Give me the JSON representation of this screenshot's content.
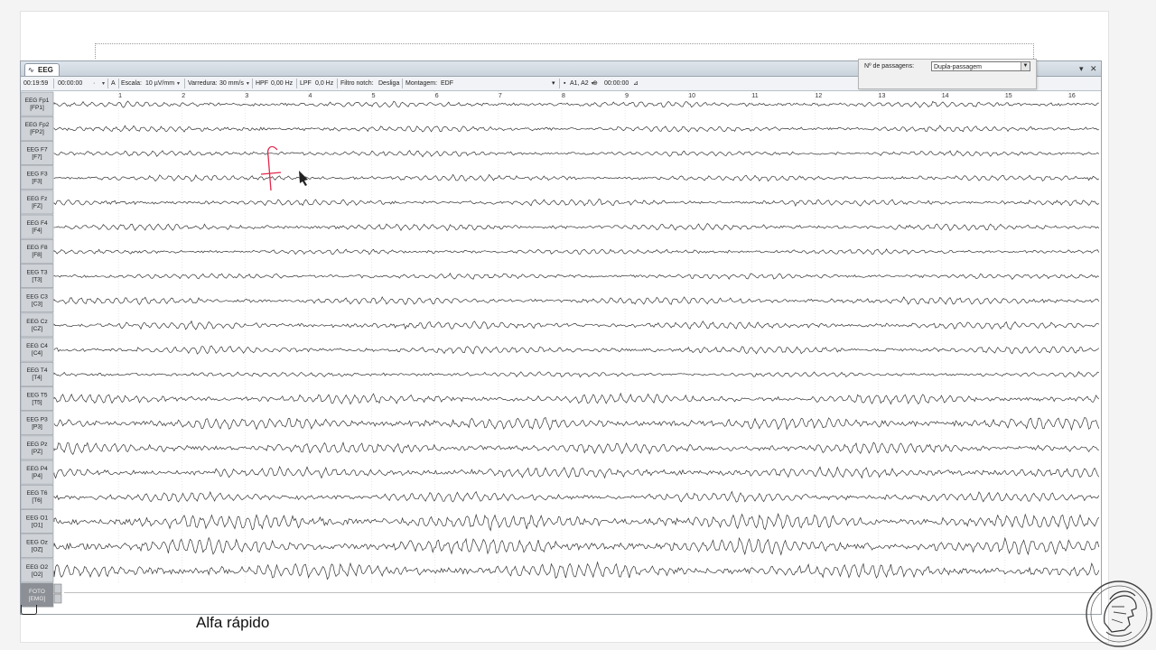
{
  "tab": {
    "label": "EEG",
    "icon": "waveform-icon"
  },
  "window_buttons": {
    "menu": "▾",
    "close": "✕"
  },
  "toolbar": {
    "time_start": "00:19:59",
    "time_current": "00:00:00",
    "scale_label": "Escala:",
    "scale_value": "10 µV/mm",
    "sweep_label": "Varredura:",
    "sweep_value": "30 mm/s",
    "hpf_label": "HPF",
    "hpf_value": "0,00 Hz",
    "lpf_label": "LPF",
    "lpf_value": "0,0 Hz",
    "notch_label": "Filtro notch:",
    "notch_value": "Desliga",
    "montage_label": "Montagem:",
    "montage_value": "EDF",
    "reference_value": "A1, A2",
    "time_marker": "00:00:00",
    "a_button": "A"
  },
  "passes_panel": {
    "label": "Nº de passagens:",
    "value": "Dupla-passagem"
  },
  "chart_data": {
    "type": "line",
    "x_ticks": [
      "1",
      "2",
      "3",
      "4",
      "5",
      "6",
      "7",
      "8",
      "9",
      "10",
      "11",
      "12",
      "13",
      "14",
      "15",
      "16"
    ],
    "channels": [
      {
        "name": "EEG Fp1",
        "electrode": "[FP1]",
        "amplitude": 2.2
      },
      {
        "name": "EEG Fp2",
        "electrode": "[FP2]",
        "amplitude": 2.4
      },
      {
        "name": "EEG F7",
        "electrode": "[F7]",
        "amplitude": 2.2
      },
      {
        "name": "EEG F3",
        "electrode": "[F3]",
        "amplitude": 2.4
      },
      {
        "name": "EEG Fz",
        "electrode": "[FZ]",
        "amplitude": 2.6
      },
      {
        "name": "EEG F4",
        "electrode": "[F4]",
        "amplitude": 2.6
      },
      {
        "name": "EEG F8",
        "electrode": "[F8]",
        "amplitude": 2.0
      },
      {
        "name": "EEG T3",
        "electrode": "[T3]",
        "amplitude": 2.2
      },
      {
        "name": "EEG C3",
        "electrode": "[C3]",
        "amplitude": 3.0
      },
      {
        "name": "EEG Cz",
        "electrode": "[CZ]",
        "amplitude": 3.2
      },
      {
        "name": "EEG C4",
        "electrode": "[C4]",
        "amplitude": 3.0
      },
      {
        "name": "EEG T4",
        "electrode": "[T4]",
        "amplitude": 2.0
      },
      {
        "name": "EEG T5",
        "electrode": "[T5]",
        "amplitude": 4.0
      },
      {
        "name": "EEG P3",
        "electrode": "[P3]",
        "amplitude": 5.0
      },
      {
        "name": "EEG Pz",
        "electrode": "[PZ]",
        "amplitude": 4.5
      },
      {
        "name": "EEG P4",
        "electrode": "[P4]",
        "amplitude": 4.5
      },
      {
        "name": "EEG T6",
        "electrode": "[T6]",
        "amplitude": 4.0
      },
      {
        "name": "EEG O1",
        "electrode": "[O1]",
        "amplitude": 6.5
      },
      {
        "name": "EEG Oz",
        "electrode": "[OZ]",
        "amplitude": 6.5
      },
      {
        "name": "EEG O2",
        "electrode": "[O2]",
        "amplitude": 6.5
      },
      {
        "name": "FOTO",
        "electrode": "[EMG]",
        "amplitude": 0
      }
    ],
    "colors": {
      "trace": "#333333",
      "grid": "#d8d8d8",
      "label_bg": "#cfd3d8",
      "foto_bg": "#8c9096"
    }
  },
  "annotation": {
    "letter": "f",
    "color": "#e0284b"
  },
  "caption": "Alfa rápido",
  "logo": {
    "icon": "athena-helmet-logo"
  }
}
